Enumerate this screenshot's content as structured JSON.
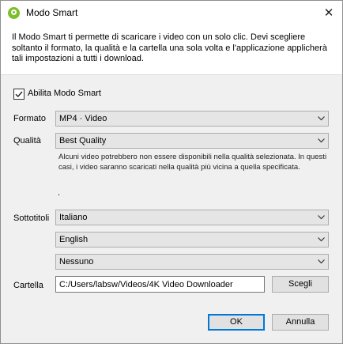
{
  "window": {
    "title": "Modo Smart",
    "close_glyph": "✕",
    "app_icon": "4k-downloader-logo-icon"
  },
  "description": "Il Modo Smart ti permette di scaricare i video con un solo clic. Devi scegliere soltanto il formato, la qualità e la cartella una sola volta e l'applicazione applicherà tali impostazioni a tutti i download.",
  "enable": {
    "label": "Abilita Modo Smart",
    "checked": true
  },
  "format": {
    "label": "Formato",
    "value": "MP4 · Video"
  },
  "quality": {
    "label": "Qualità",
    "value": "Best Quality",
    "note": "Alcuni video potrebbero non essere disponibili nella qualità selezionata. In questi casi, i video saranno scaricati nella qualità più vicina a quella specificata.",
    "dot": "."
  },
  "subtitles": {
    "label": "Sottotitoli",
    "values": [
      "Italiano",
      "English",
      "Nessuno"
    ]
  },
  "folder": {
    "label": "Cartella",
    "path": "C:/Users/labsw/Videos/4K Video Downloader",
    "browse_label": "Scegli"
  },
  "buttons": {
    "ok": "OK",
    "cancel": "Annulla"
  }
}
